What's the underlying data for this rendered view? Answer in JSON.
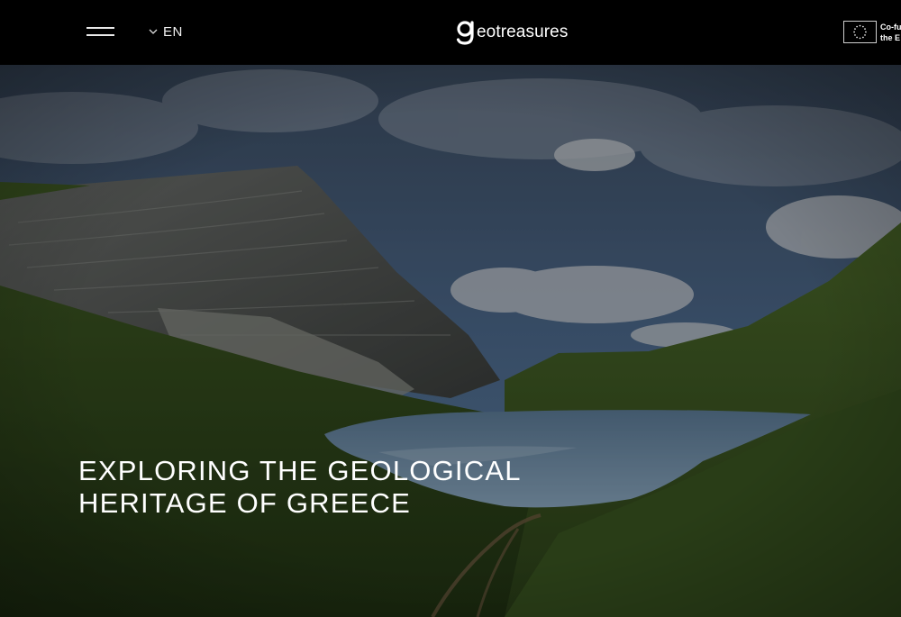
{
  "header": {
    "menu_icon": "hamburger-icon",
    "language": {
      "label": "EN",
      "icon": "chevron-down-icon"
    },
    "logo": {
      "text": "eotreasures",
      "mark": "g"
    },
    "eu_badge": {
      "line1": "Co-fu",
      "line2": "the E"
    }
  },
  "hero": {
    "title_line1": "EXPLORING THE GEOLOGICAL",
    "title_line2": "HERITAGE OF GREECE"
  }
}
